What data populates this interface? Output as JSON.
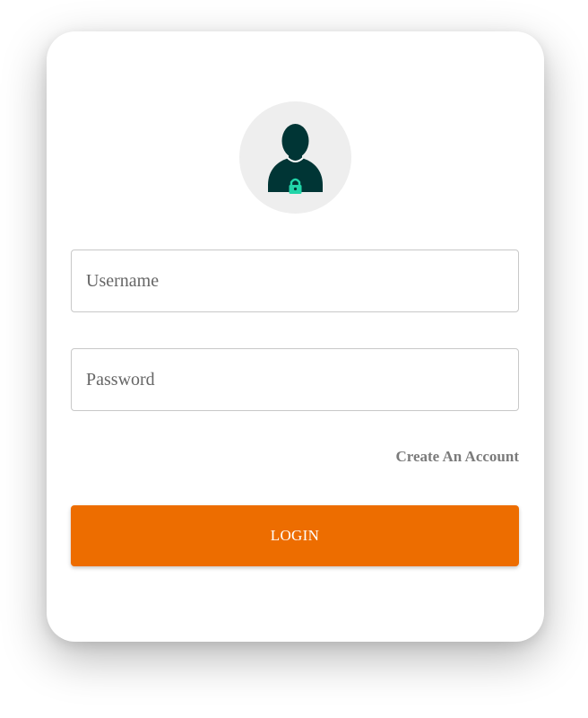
{
  "avatar": {
    "icon": "user-lock-icon",
    "background_color": "#eeeeee",
    "figure_color": "#003535",
    "lock_color": "#22d4a8"
  },
  "form": {
    "username_placeholder": "Username",
    "username_value": "",
    "password_placeholder": "Password",
    "password_value": "",
    "create_account_label": "Create An Account",
    "login_label": "LOGIN"
  },
  "colors": {
    "accent": "#ed6d00",
    "link": "#7b7b7b",
    "input_border": "#c8c8c8"
  }
}
